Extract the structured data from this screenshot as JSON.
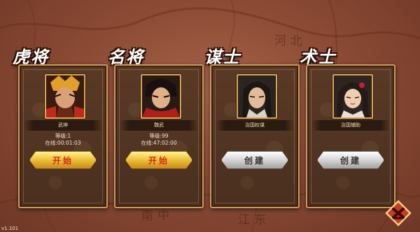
{
  "map_labels": [
    "河北",
    "南中",
    "江东"
  ],
  "version": "v1.101",
  "cards": [
    {
      "title": "虎将",
      "name": "武神",
      "level": "等级:1",
      "online": "在线:00:01:03",
      "button": "开始",
      "button_style": "gold",
      "portrait": "red-armored-warrior-portrait"
    },
    {
      "title": "名将",
      "name": "魏武",
      "level": "等级:99",
      "online": "在线:47:02:00",
      "button": "开始",
      "button_style": "gold",
      "portrait": "red-scarf-general-portrait"
    },
    {
      "title": "谋士",
      "name": "治国权谋",
      "level": "",
      "online": "",
      "button": "创建",
      "button_style": "silver",
      "portrait": "long-haired-strategist-portrait"
    },
    {
      "title": "术士",
      "name": "治国辅助",
      "level": "",
      "online": "",
      "button": "创建",
      "button_style": "silver",
      "portrait": "female-mystic-portrait"
    }
  ],
  "colors": {
    "gold_button_text": "#d12a1a",
    "silver_button_text": "#333333",
    "frame": "#c79a5a"
  },
  "icons": {
    "exit": "exit-icon"
  }
}
